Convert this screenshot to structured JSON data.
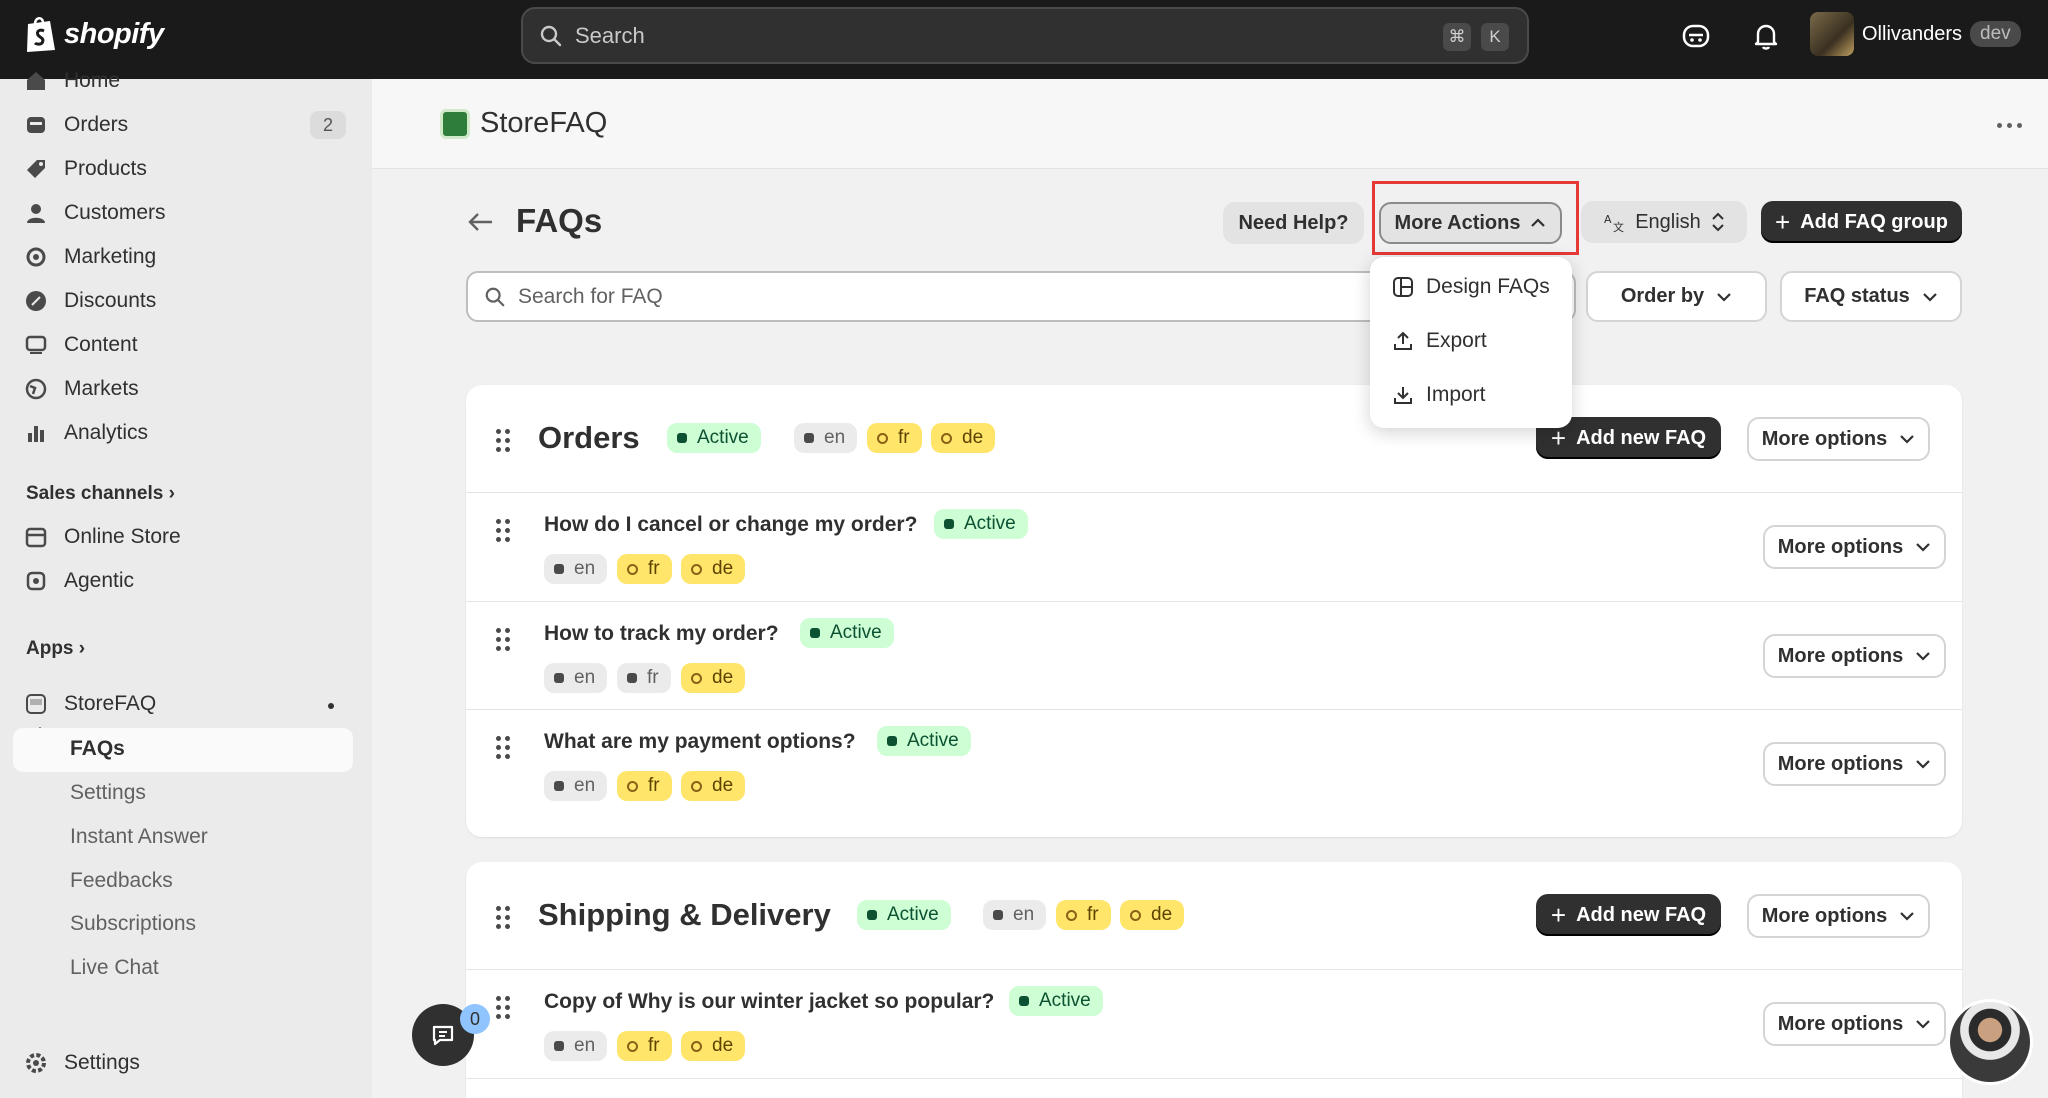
{
  "topbar": {
    "logo_text": "shopify",
    "search_placeholder": "Search",
    "shortcut_cmd": "⌘",
    "shortcut_key": "K",
    "user_name": "Ollivanders",
    "user_badge": "dev"
  },
  "sidebar": {
    "items": [
      {
        "label": "Home",
        "icon": "home-icon"
      },
      {
        "label": "Orders",
        "icon": "orders-icon",
        "count": "2"
      },
      {
        "label": "Products",
        "icon": "tag-icon"
      },
      {
        "label": "Customers",
        "icon": "person-icon"
      },
      {
        "label": "Marketing",
        "icon": "target-icon"
      },
      {
        "label": "Discounts",
        "icon": "discount-icon"
      },
      {
        "label": "Content",
        "icon": "content-icon"
      },
      {
        "label": "Markets",
        "icon": "globe-icon"
      },
      {
        "label": "Analytics",
        "icon": "bar-chart-icon"
      }
    ],
    "sales_channels_label": "Sales channels",
    "channels": [
      {
        "label": "Online Store",
        "icon": "store-icon"
      },
      {
        "label": "Agentic",
        "icon": "agentic-icon"
      }
    ],
    "apps_label": "Apps",
    "app_name": "StoreFAQ",
    "app_subitems": [
      "FAQs",
      "Settings",
      "Instant Answer",
      "Feedbacks",
      "Subscriptions",
      "Live Chat"
    ],
    "settings_label": "Settings"
  },
  "app_header": {
    "title": "StoreFAQ"
  },
  "page": {
    "title": "FAQs",
    "need_help": "Need Help?",
    "more_actions": "More Actions",
    "language": "English",
    "add_group": "Add FAQ group",
    "search_placeholder": "Search for FAQ",
    "order_by": "Order by",
    "faq_status": "FAQ status"
  },
  "dropdown": {
    "items": [
      {
        "label": "Design FAQs",
        "icon": "layout-icon"
      },
      {
        "label": "Export",
        "icon": "upload-icon"
      },
      {
        "label": "Import",
        "icon": "download-icon"
      }
    ]
  },
  "groups": [
    {
      "title": "Orders",
      "status": "Active",
      "langs": [
        "en",
        "fr",
        "de"
      ],
      "add_label": "Add new FAQ",
      "more_label": "More options",
      "faqs": [
        {
          "q": "How do I cancel or change my order?",
          "status": "Active",
          "langs": [
            "en",
            "fr",
            "de"
          ],
          "more": "More options"
        },
        {
          "q": "How to track my order?",
          "status": "Active",
          "langs": [
            "en",
            "fr",
            "de"
          ],
          "more": "More options"
        },
        {
          "q": "What are my payment options?",
          "status": "Active",
          "langs": [
            "en",
            "fr",
            "de"
          ],
          "more": "More options"
        }
      ]
    },
    {
      "title": "Shipping & Delivery",
      "status": "Active",
      "langs": [
        "en",
        "fr",
        "de"
      ],
      "add_label": "Add new FAQ",
      "more_label": "More options",
      "faqs": [
        {
          "q": "Copy of Why is our winter jacket so popular?",
          "status": "Active",
          "langs": [
            "en",
            "fr",
            "de"
          ],
          "more": "More options"
        }
      ]
    }
  ],
  "chat": {
    "count": "0"
  },
  "colors": {
    "topbar": "#1a1a1a",
    "active_green": "#cdfed4",
    "lang_yellow": "#ffe66b",
    "highlight_red": "#e53935"
  }
}
